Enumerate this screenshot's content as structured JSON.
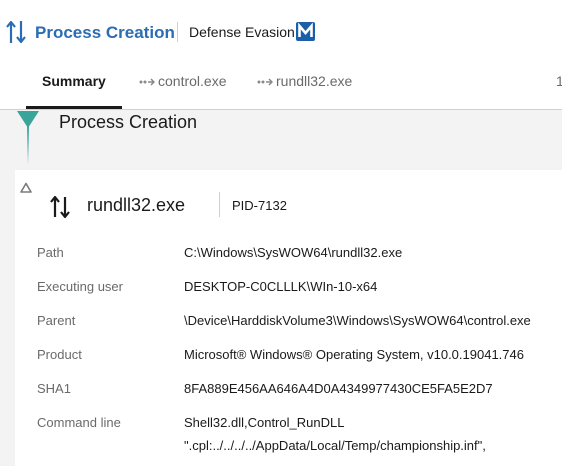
{
  "header": {
    "title": "Process Creation",
    "tactic": "Defense Evasion",
    "mitre_badge": "M",
    "icon": "process-arrows-icon"
  },
  "tabs": [
    {
      "label": "Summary",
      "active": true
    },
    {
      "label": "control.exe",
      "icon": "process-chain-icon"
    },
    {
      "label": "rundll32.exe",
      "icon": "process-chain-icon"
    },
    {
      "label": "1",
      "note": "partially visible"
    }
  ],
  "section": {
    "title": "Process Creation"
  },
  "process": {
    "name": "rundll32.exe",
    "pid": "PID-7132",
    "details": [
      {
        "label": "Path",
        "value": "C:\\Windows\\SysWOW64\\rundll32.exe"
      },
      {
        "label": "Executing user",
        "value": "DESKTOP-C0CLLLK\\WIn-10-x64"
      },
      {
        "label": "Parent",
        "value": "\\Device\\HarddiskVolume3\\Windows\\SysWOW64\\control.exe"
      },
      {
        "label": "Product",
        "value": "Microsoft® Windows® Operating System, v10.0.19041.746"
      },
      {
        "label": "SHA1",
        "value": "8FA889E456AA646A4D0A4349977430CE5FA5E2D7"
      },
      {
        "label": "Command line",
        "value": "Shell32.dll,Control_RunDLL",
        "value2": "\".cpl:../../../../AppData/Local/Temp/championship.inf\","
      }
    ]
  },
  "colors": {
    "accent": "#2b6cb5",
    "mitre": "#1d5ea8",
    "marker": "#3aa39a"
  }
}
